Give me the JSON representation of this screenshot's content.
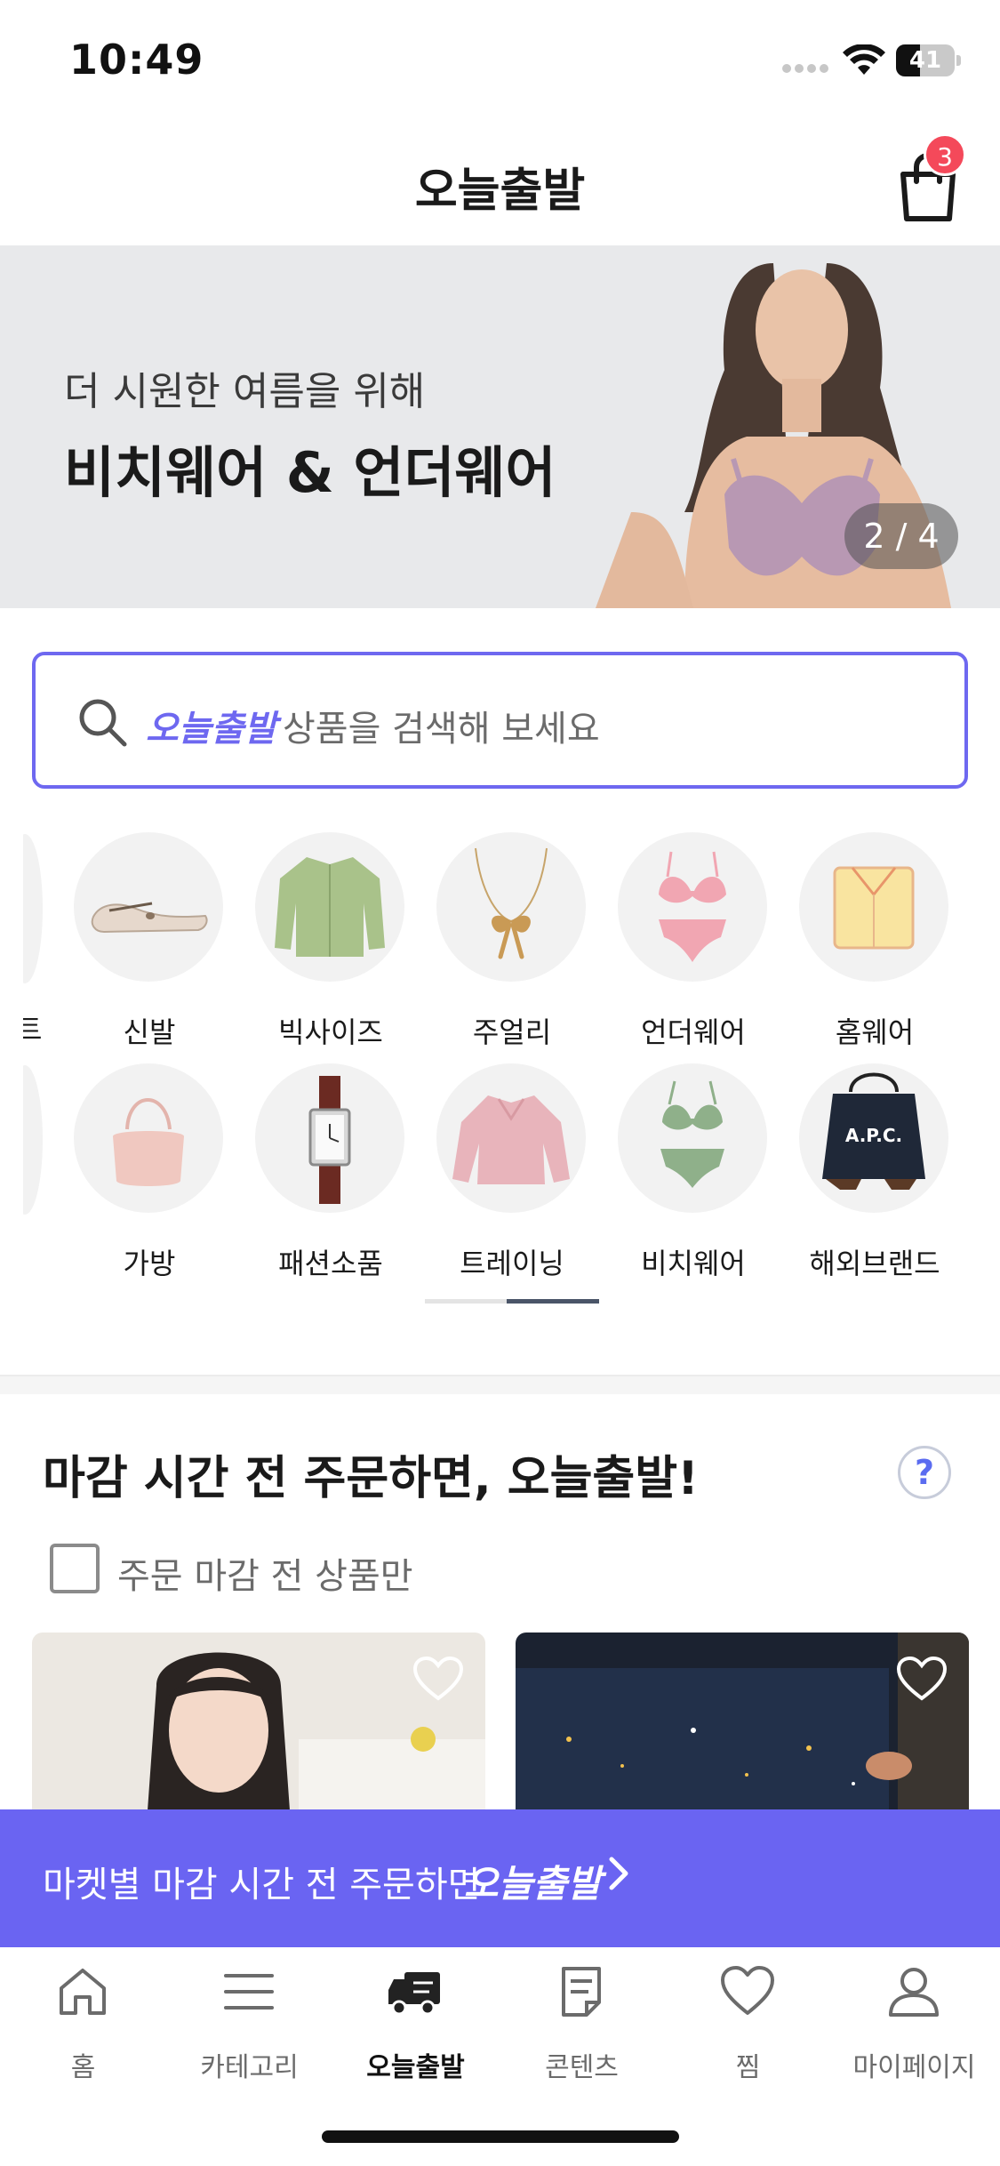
{
  "status_bar": {
    "time": "10:49",
    "battery": "41",
    "battery_level": 0.41
  },
  "header": {
    "title": "오늘출발",
    "cart_count": "3"
  },
  "banner": {
    "subtitle": "더 시원한 여름을 위해",
    "title": "비치웨어 & 언더웨어",
    "pager": "2 / 4"
  },
  "search": {
    "brand": "오늘출발",
    "placeholder": "상품을 검색해 보세요"
  },
  "categories": {
    "row1": [
      {
        "label": "신발",
        "icon": "shoe-icon"
      },
      {
        "label": "빅사이즈",
        "icon": "blouse-icon"
      },
      {
        "label": "주얼리",
        "icon": "necklace-icon"
      },
      {
        "label": "언더웨어",
        "icon": "lingerie-icon"
      },
      {
        "label": "홈웨어",
        "icon": "pajama-icon"
      }
    ],
    "row2": [
      {
        "label": "가방",
        "icon": "handbag-icon"
      },
      {
        "label": "패션소품",
        "icon": "watch-icon"
      },
      {
        "label": "트레이닝",
        "icon": "sweatshirt-icon"
      },
      {
        "label": "비치웨어",
        "icon": "bikini-icon"
      },
      {
        "label": "해외브랜드",
        "icon": "tote-bag-icon"
      }
    ],
    "partial_label": "트",
    "scroll_position": 0.5
  },
  "deadline_section": {
    "title": "마감 시간 전 주문하면, 오늘출발!",
    "help": "?",
    "filter_label": "주문 마감 전 상품만"
  },
  "promo_bar": {
    "text": "마켓별 마감 시간 전 주문하면",
    "brand": "오늘출발"
  },
  "bottom_nav": {
    "items": [
      {
        "label": "홈",
        "icon": "home-icon"
      },
      {
        "label": "카테고리",
        "icon": "menu-icon"
      },
      {
        "label": "오늘출발",
        "icon": "truck-icon",
        "active": true
      },
      {
        "label": "콘텐츠",
        "icon": "document-icon"
      },
      {
        "label": "찜",
        "icon": "heart-icon"
      },
      {
        "label": "마이페이지",
        "icon": "person-icon"
      }
    ]
  },
  "colors": {
    "accent": "#6e68f0",
    "promo": "#6a64f2",
    "badge": "#f4495a"
  }
}
